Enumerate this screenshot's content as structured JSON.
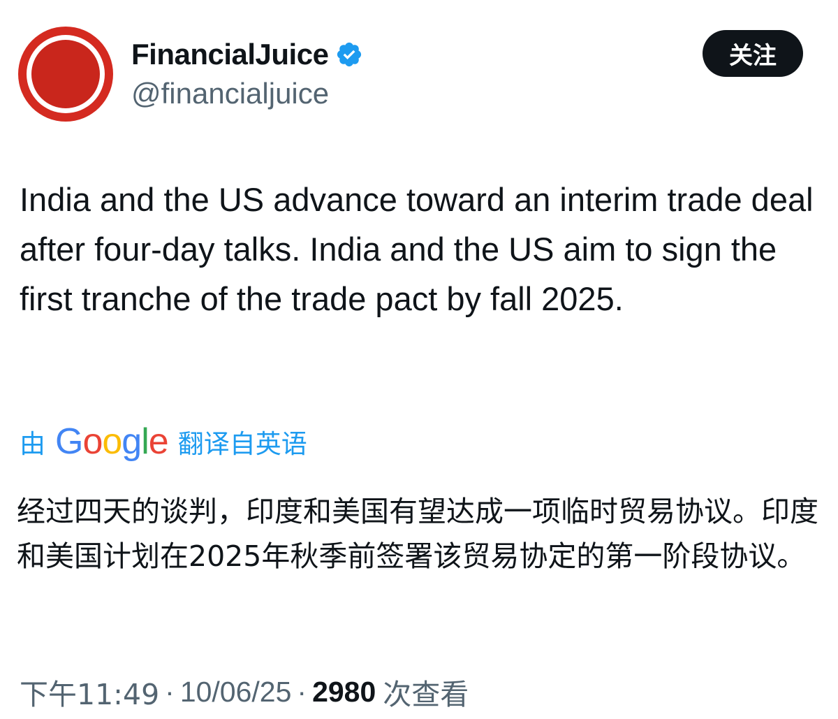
{
  "author": {
    "display_name": "FinancialJuice",
    "handle": "@financialjuice",
    "verified_icon": "verified-badge-icon",
    "avatar_icon": "red-circle-logo",
    "colors": {
      "avatar_red": "#d42a20",
      "verified_blue": "#1d9bf0"
    }
  },
  "follow_button": {
    "label": "关注"
  },
  "tweet": {
    "text": "India and the US advance toward an interim trade deal after four-day talks. India and the US aim to sign the first tranche of the trade pact by fall 2025."
  },
  "translation": {
    "prefix": "由",
    "provider": "Google",
    "suffix": "翻译自英语",
    "text": "经过四天的谈判，印度和美国有望达成一项临时贸易协议。印度和美国计划在2025年秋季前签署该贸易协定的第一阶段协议。"
  },
  "meta": {
    "time": "下午11:49",
    "separator": "·",
    "date": "10/06/25",
    "views_count": "2980",
    "views_label": "次查看"
  }
}
